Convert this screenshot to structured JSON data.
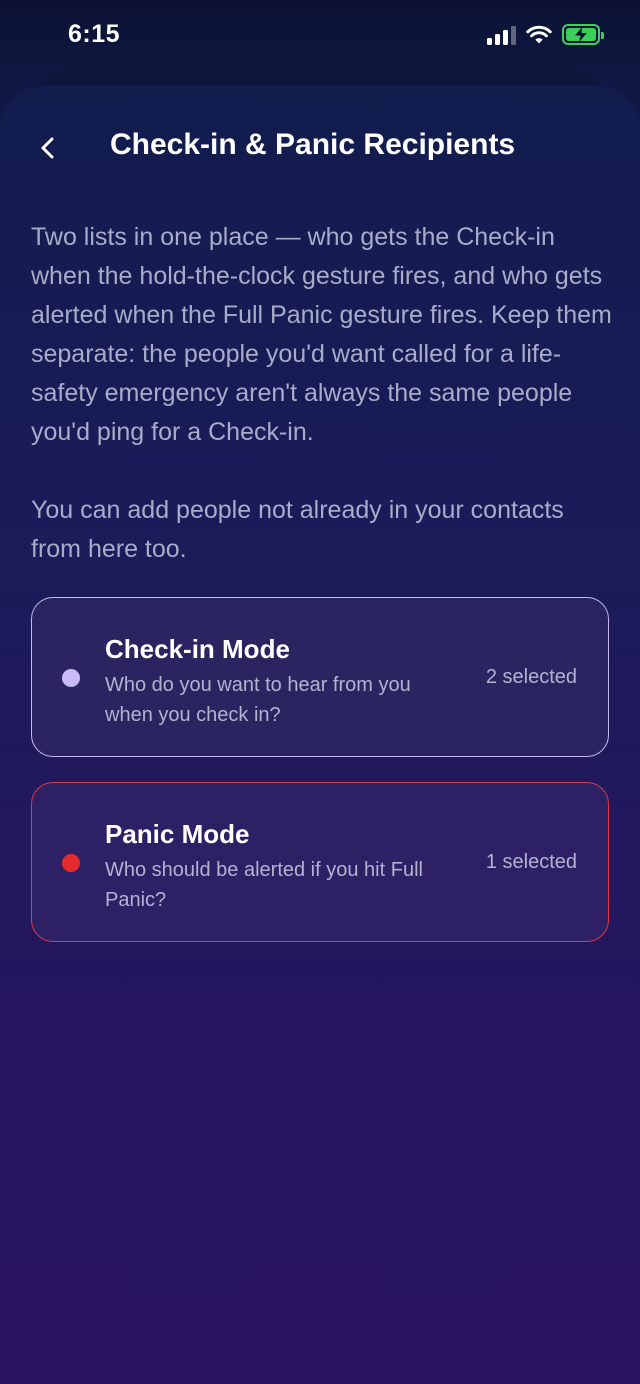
{
  "status_bar": {
    "time": "6:15",
    "icons": [
      "cellular-signal-icon",
      "wifi-icon",
      "battery-charging-icon"
    ]
  },
  "header": {
    "back_icon": "chevron-left-icon",
    "title": "Check-in & Panic Recipients"
  },
  "description": {
    "paragraph1": "Two lists in one place — who gets the Check-in when the hold-the-clock gesture fires, and who gets alerted when the Full Panic gesture fires. Keep them separate: the people you'd want called for a life-safety emergency aren't always the same people you'd ping for a Check-in.",
    "paragraph2": "You can add people not already in your contacts from here too."
  },
  "modes": [
    {
      "title": "Check-in Mode",
      "subtitle": "Who do you want to hear from you when you check in?",
      "count": "2 selected",
      "color": "#c9bbf5"
    },
    {
      "title": "Panic Mode",
      "subtitle": "Who should be alerted if you hit Full Panic?",
      "count": "1 selected",
      "color": "#e52b2b"
    }
  ]
}
